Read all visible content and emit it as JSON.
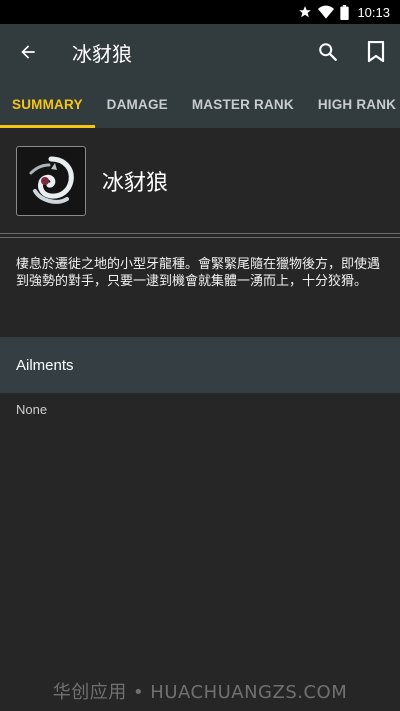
{
  "status_bar": {
    "time": "10:13"
  },
  "app_bar": {
    "title": "冰豺狼"
  },
  "tabs": [
    {
      "label": "SUMMARY",
      "active": true
    },
    {
      "label": "DAMAGE",
      "active": false
    },
    {
      "label": "MASTER RANK",
      "active": false
    },
    {
      "label": "HIGH RANK",
      "active": false
    }
  ],
  "monster": {
    "name": "冰豺狼",
    "description": "棲息於遷徙之地的小型牙龍種。會緊緊尾隨在獵物後方，即使遇到強勢的對手，只要一逮到機會就集體一湧而上，十分狡猾。"
  },
  "ailments": {
    "header": "Ailments",
    "value": "None"
  },
  "watermark": "华创应用 • HUACHUANGZS.COM",
  "colors": {
    "accent": "#f5c518",
    "app_bar": "#323b3e",
    "background": "#262626"
  }
}
